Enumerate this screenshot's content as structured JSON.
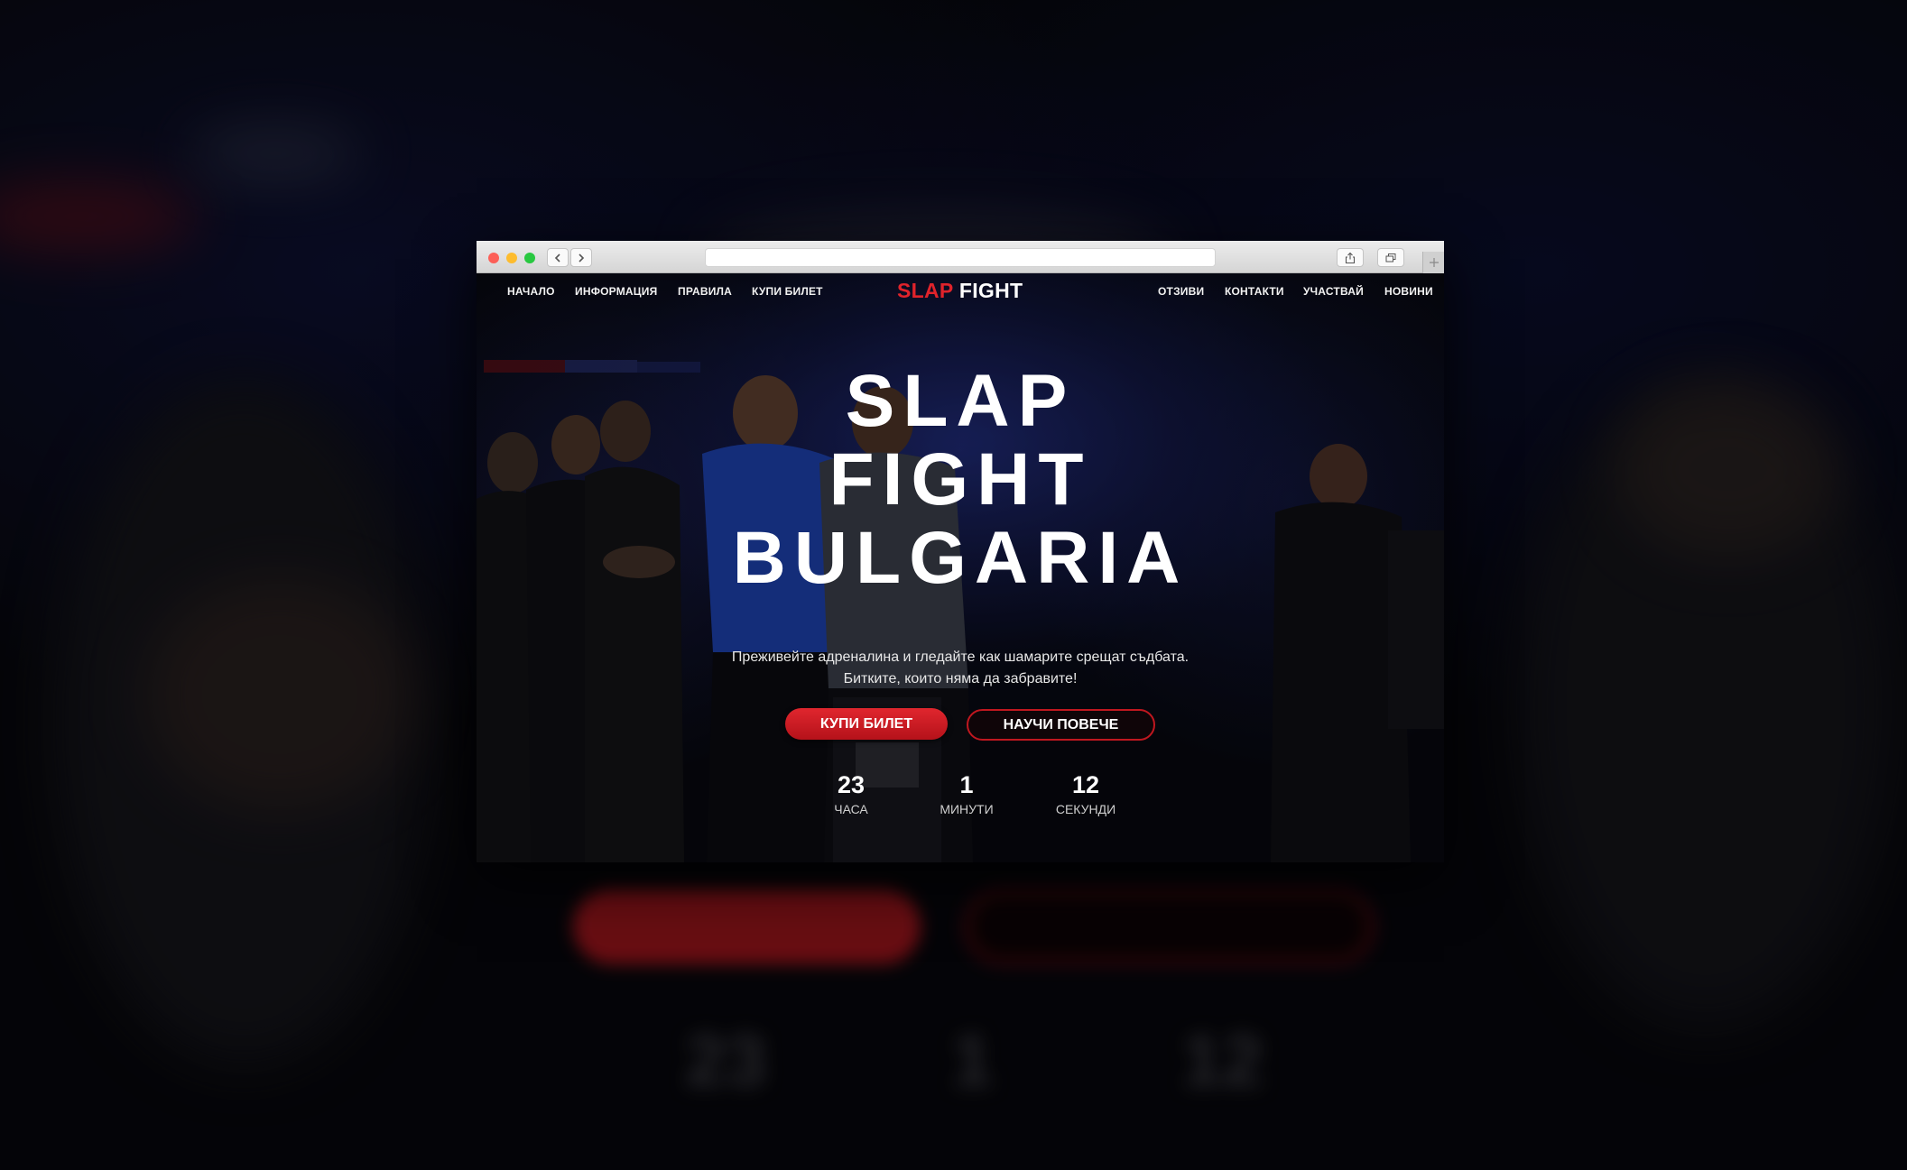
{
  "nav": {
    "left": [
      "НАЧАЛО",
      "ИНФОРМАЦИЯ",
      "ПРАВИЛА",
      "КУПИ БИЛЕТ"
    ],
    "right": [
      "ОТЗИВИ",
      "КОНТАКТИ",
      "УЧАСТВАЙ",
      "НОВИНИ"
    ]
  },
  "logo": {
    "part1": "SLAP",
    "part2": "FIGHT"
  },
  "hero": {
    "title_lines": [
      "SLAP",
      "FIGHT",
      "BULGARIA"
    ],
    "subtitle_lines": [
      "Преживейте адреналина и гледайте как шамарите срещат съдбата.",
      "Битките, които няма да забравите!"
    ],
    "primary_button": "КУПИ БИЛЕТ",
    "secondary_button": "НАУЧИ ПОВЕЧЕ"
  },
  "countdown": [
    {
      "value": "23",
      "label": "ЧАСА"
    },
    {
      "value": "1",
      "label": "МИНУТИ"
    },
    {
      "value": "12",
      "label": "СЕКУНДИ"
    }
  ],
  "colors": {
    "accent_red": "#e0232b",
    "button_red": "#c61a22",
    "text_white": "#ffffff"
  },
  "icons": [
    "back-arrow-icon",
    "forward-arrow-icon",
    "share-icon",
    "tabs-icon",
    "plus-icon"
  ]
}
